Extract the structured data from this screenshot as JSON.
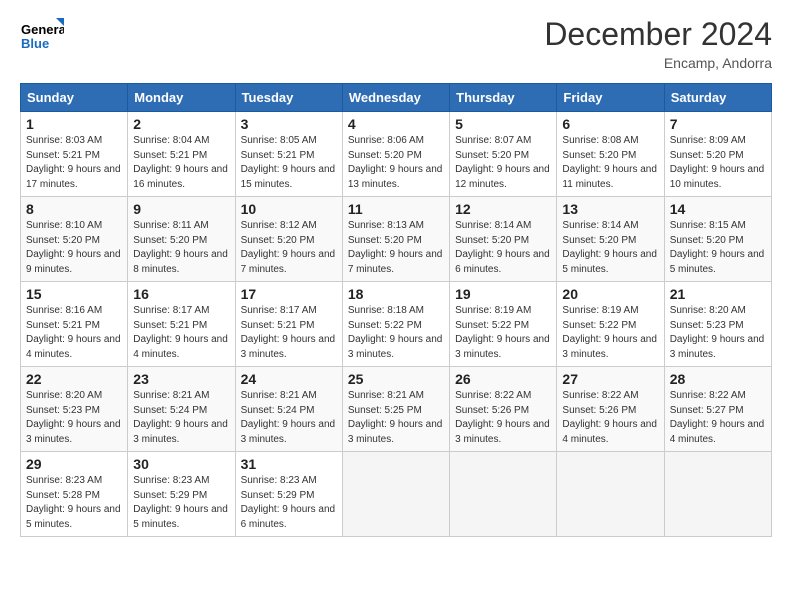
{
  "logo": {
    "line1": "General",
    "line2": "Blue"
  },
  "title": "December 2024",
  "location": "Encamp, Andorra",
  "days_of_week": [
    "Sunday",
    "Monday",
    "Tuesday",
    "Wednesday",
    "Thursday",
    "Friday",
    "Saturday"
  ],
  "weeks": [
    [
      {
        "day": "1",
        "sunrise": "8:03 AM",
        "sunset": "5:21 PM",
        "daylight": "9 hours and 17 minutes."
      },
      {
        "day": "2",
        "sunrise": "8:04 AM",
        "sunset": "5:21 PM",
        "daylight": "9 hours and 16 minutes."
      },
      {
        "day": "3",
        "sunrise": "8:05 AM",
        "sunset": "5:21 PM",
        "daylight": "9 hours and 15 minutes."
      },
      {
        "day": "4",
        "sunrise": "8:06 AM",
        "sunset": "5:20 PM",
        "daylight": "9 hours and 13 minutes."
      },
      {
        "day": "5",
        "sunrise": "8:07 AM",
        "sunset": "5:20 PM",
        "daylight": "9 hours and 12 minutes."
      },
      {
        "day": "6",
        "sunrise": "8:08 AM",
        "sunset": "5:20 PM",
        "daylight": "9 hours and 11 minutes."
      },
      {
        "day": "7",
        "sunrise": "8:09 AM",
        "sunset": "5:20 PM",
        "daylight": "9 hours and 10 minutes."
      }
    ],
    [
      {
        "day": "8",
        "sunrise": "8:10 AM",
        "sunset": "5:20 PM",
        "daylight": "9 hours and 9 minutes."
      },
      {
        "day": "9",
        "sunrise": "8:11 AM",
        "sunset": "5:20 PM",
        "daylight": "9 hours and 8 minutes."
      },
      {
        "day": "10",
        "sunrise": "8:12 AM",
        "sunset": "5:20 PM",
        "daylight": "9 hours and 7 minutes."
      },
      {
        "day": "11",
        "sunrise": "8:13 AM",
        "sunset": "5:20 PM",
        "daylight": "9 hours and 7 minutes."
      },
      {
        "day": "12",
        "sunrise": "8:14 AM",
        "sunset": "5:20 PM",
        "daylight": "9 hours and 6 minutes."
      },
      {
        "day": "13",
        "sunrise": "8:14 AM",
        "sunset": "5:20 PM",
        "daylight": "9 hours and 5 minutes."
      },
      {
        "day": "14",
        "sunrise": "8:15 AM",
        "sunset": "5:20 PM",
        "daylight": "9 hours and 5 minutes."
      }
    ],
    [
      {
        "day": "15",
        "sunrise": "8:16 AM",
        "sunset": "5:21 PM",
        "daylight": "9 hours and 4 minutes."
      },
      {
        "day": "16",
        "sunrise": "8:17 AM",
        "sunset": "5:21 PM",
        "daylight": "9 hours and 4 minutes."
      },
      {
        "day": "17",
        "sunrise": "8:17 AM",
        "sunset": "5:21 PM",
        "daylight": "9 hours and 3 minutes."
      },
      {
        "day": "18",
        "sunrise": "8:18 AM",
        "sunset": "5:22 PM",
        "daylight": "9 hours and 3 minutes."
      },
      {
        "day": "19",
        "sunrise": "8:19 AM",
        "sunset": "5:22 PM",
        "daylight": "9 hours and 3 minutes."
      },
      {
        "day": "20",
        "sunrise": "8:19 AM",
        "sunset": "5:22 PM",
        "daylight": "9 hours and 3 minutes."
      },
      {
        "day": "21",
        "sunrise": "8:20 AM",
        "sunset": "5:23 PM",
        "daylight": "9 hours and 3 minutes."
      }
    ],
    [
      {
        "day": "22",
        "sunrise": "8:20 AM",
        "sunset": "5:23 PM",
        "daylight": "9 hours and 3 minutes."
      },
      {
        "day": "23",
        "sunrise": "8:21 AM",
        "sunset": "5:24 PM",
        "daylight": "9 hours and 3 minutes."
      },
      {
        "day": "24",
        "sunrise": "8:21 AM",
        "sunset": "5:24 PM",
        "daylight": "9 hours and 3 minutes."
      },
      {
        "day": "25",
        "sunrise": "8:21 AM",
        "sunset": "5:25 PM",
        "daylight": "9 hours and 3 minutes."
      },
      {
        "day": "26",
        "sunrise": "8:22 AM",
        "sunset": "5:26 PM",
        "daylight": "9 hours and 3 minutes."
      },
      {
        "day": "27",
        "sunrise": "8:22 AM",
        "sunset": "5:26 PM",
        "daylight": "9 hours and 4 minutes."
      },
      {
        "day": "28",
        "sunrise": "8:22 AM",
        "sunset": "5:27 PM",
        "daylight": "9 hours and 4 minutes."
      }
    ],
    [
      {
        "day": "29",
        "sunrise": "8:23 AM",
        "sunset": "5:28 PM",
        "daylight": "9 hours and 5 minutes."
      },
      {
        "day": "30",
        "sunrise": "8:23 AM",
        "sunset": "5:29 PM",
        "daylight": "9 hours and 5 minutes."
      },
      {
        "day": "31",
        "sunrise": "8:23 AM",
        "sunset": "5:29 PM",
        "daylight": "9 hours and 6 minutes."
      },
      null,
      null,
      null,
      null
    ]
  ],
  "labels": {
    "sunrise": "Sunrise:",
    "sunset": "Sunset:",
    "daylight": "Daylight:"
  }
}
